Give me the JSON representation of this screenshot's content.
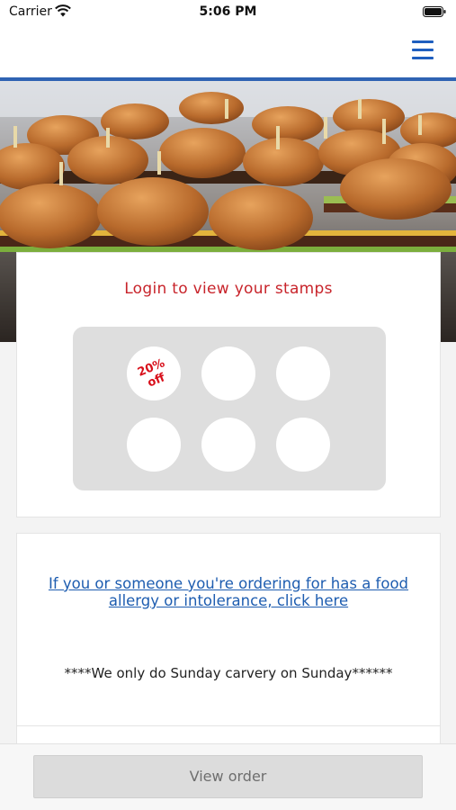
{
  "status_bar": {
    "carrier": "Carrier",
    "time": "5:06 PM",
    "wifi_icon": "wifi-icon",
    "battery_icon": "battery-icon"
  },
  "nav": {
    "menu_icon": "hamburger-menu-icon",
    "accent_color": "#2f63b3"
  },
  "hero": {
    "image": "tray of sliders burgers with wooden skewers"
  },
  "loyalty": {
    "title": "Login to view your stamps",
    "reward_stamp_text": "20% off",
    "stamp_slots": 6,
    "title_color": "#c8242b"
  },
  "info": {
    "allergy_link": "If you or someone you're ordering for has a food allergy or intolerance, click here",
    "notice": "****We only do Sunday carvery on Sunday******",
    "link_color": "#1e5db0"
  },
  "footer": {
    "view_order_label": "View order"
  }
}
